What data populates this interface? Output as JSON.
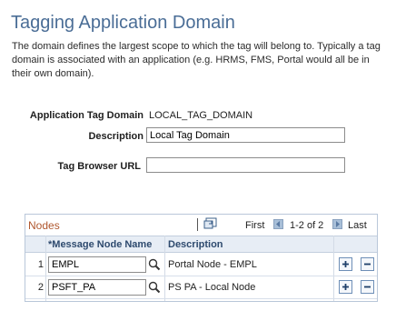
{
  "page": {
    "title": "Tagging Application Domain",
    "intro": "The domain defines the largest scope to which the tag will belong to. Typically a tag domain is associated with an application (e.g. HRMS, FMS, Portal would all be in their own domain)."
  },
  "form": {
    "app_tag_domain_label": "Application Tag Domain",
    "app_tag_domain_value": "LOCAL_TAG_DOMAIN",
    "description_label": "Description",
    "description_value": "Local Tag Domain",
    "tag_browser_url_label": "Tag Browser URL",
    "tag_browser_url_value": ""
  },
  "grid": {
    "title": "Nodes",
    "nav": {
      "first": "First",
      "range": "1-2 of 2",
      "last": "Last"
    },
    "columns": {
      "node_name": "*Message Node Name",
      "description": "Description"
    },
    "rows": [
      {
        "num": "1",
        "node": "EMPL",
        "description": "Portal Node - EMPL"
      },
      {
        "num": "2",
        "node": "PSFT_PA",
        "description": "PS PA - Local Node"
      }
    ]
  },
  "icons": {
    "view_all": "grid-view-icon",
    "prev": "nav-prev-icon",
    "next": "nav-next-icon",
    "lookup": "search-icon",
    "add": "plus-icon",
    "delete": "minus-icon"
  },
  "colors": {
    "title": "#4a6d96",
    "grid_title": "#b0572e",
    "header_bg": "#e7edf5"
  }
}
